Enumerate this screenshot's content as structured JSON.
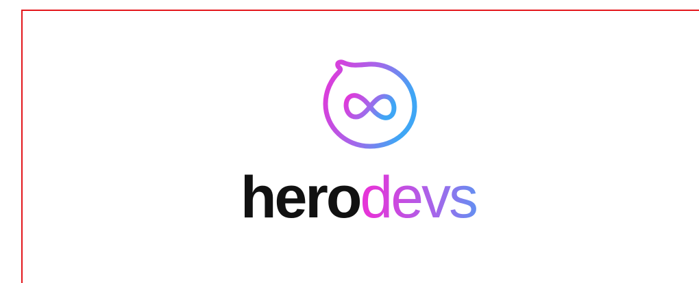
{
  "logo": {
    "wordmark": {
      "part1": "hero",
      "part2": "devs"
    },
    "mark": "infinity-bubble-icon"
  },
  "colors": {
    "frame_border": "#e3161b",
    "wordmark_dark": "#111111",
    "gradient_start": "#e535d8",
    "gradient_mid": "#a566ea",
    "gradient_end": "#3fa6f5"
  }
}
